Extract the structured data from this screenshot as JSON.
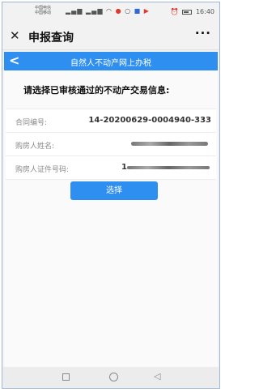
{
  "status_bar": {
    "carrier_line1": "中国电信",
    "carrier_line2": "中国移动",
    "time": "16:40"
  },
  "titlebar": {
    "title": "申报查询",
    "more_label": "···",
    "close_label": "✕"
  },
  "header": {
    "title": "自然人不动产网上办税",
    "back_label": "<"
  },
  "content": {
    "prompt": "请选择已审核通过的不动产交易信息:",
    "rows": [
      {
        "label": "合同编号:",
        "value": "14-20200629-0004940-333"
      },
      {
        "label": "购房人姓名:",
        "value": ""
      },
      {
        "label": "购房人证件号码:",
        "value": "1"
      }
    ],
    "select_label": "选择"
  },
  "icons": {
    "close": "close-icon",
    "more": "more-icon",
    "back": "back-arrow-icon",
    "nav_square": "recent-apps-icon",
    "nav_circle": "home-icon",
    "nav_back": "back-triangle-icon"
  },
  "colors": {
    "accent": "#2f8ff0",
    "background": "#f2f2f2"
  }
}
